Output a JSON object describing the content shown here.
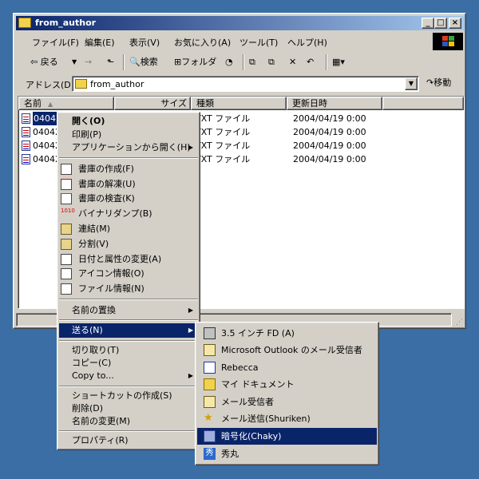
{
  "window": {
    "title": "from_author",
    "controls": {
      "minimize": "_",
      "maximize": "□",
      "close": "×"
    }
  },
  "menubar": [
    "ファイル(F)",
    "編集(E)",
    "表示(V)",
    "お気に入り(A)",
    "ツール(T)",
    "ヘルプ(H)"
  ],
  "toolbar": {
    "back": "⇦ 戻る",
    "forward_arrow": "→",
    "search": "検索",
    "folders": "フォルダ",
    "history_glyph": "◔",
    "move_glyph": "⧉",
    "copy_glyph": "⧉",
    "delete_glyph": "✕",
    "undo_glyph": "↶",
    "views_glyph": "▦▾"
  },
  "address": {
    "label": "アドレス(D)",
    "value": "from_author",
    "go": "移動"
  },
  "columns": [
    "名前",
    "サイズ",
    "種類",
    "更新日時"
  ],
  "files": [
    {
      "name": "04042",
      "type": "TXT ファイル",
      "date": "2004/04/19 0:00"
    },
    {
      "name": "04042",
      "type": "TXT ファイル",
      "date": "2004/04/19 0:00"
    },
    {
      "name": "04042",
      "type": "TXT ファイル",
      "date": "2004/04/19 0:00"
    },
    {
      "name": "04042",
      "type": "TXT ファイル",
      "date": "2004/04/19 0:00"
    }
  ],
  "context_menu": {
    "open": "開く(O)",
    "print": "印刷(P)",
    "open_with": "アプリケーションから開く(H)",
    "lib_create": "書庫の作成(F)",
    "lib_extract": "書庫の解凍(U)",
    "lib_check": "書庫の検査(K)",
    "binary_dump": "バイナリダンプ(B)",
    "concat": "連結(M)",
    "split": "分割(V)",
    "date_attr": "日付と属性の変更(A)",
    "icon_info": "アイコン情報(O)",
    "file_info": "ファイル情報(N)",
    "rename_replace": "名前の置換",
    "send_to": "送る(N)",
    "cut": "切り取り(T)",
    "copy": "コピー(C)",
    "copy_to": "Copy to...",
    "shortcut": "ショートカットの作成(S)",
    "delete": "削除(D)",
    "rename": "名前の変更(M)",
    "properties": "プロパティ(R)"
  },
  "sendto_menu": [
    "3.5 インチ FD (A)",
    "Microsoft Outlook のメール受信者",
    "Rebecca",
    "マイ ドキュメント",
    "メール受信者",
    "メール送信(Shuriken)",
    "暗号化(Chaky)",
    "秀丸"
  ]
}
